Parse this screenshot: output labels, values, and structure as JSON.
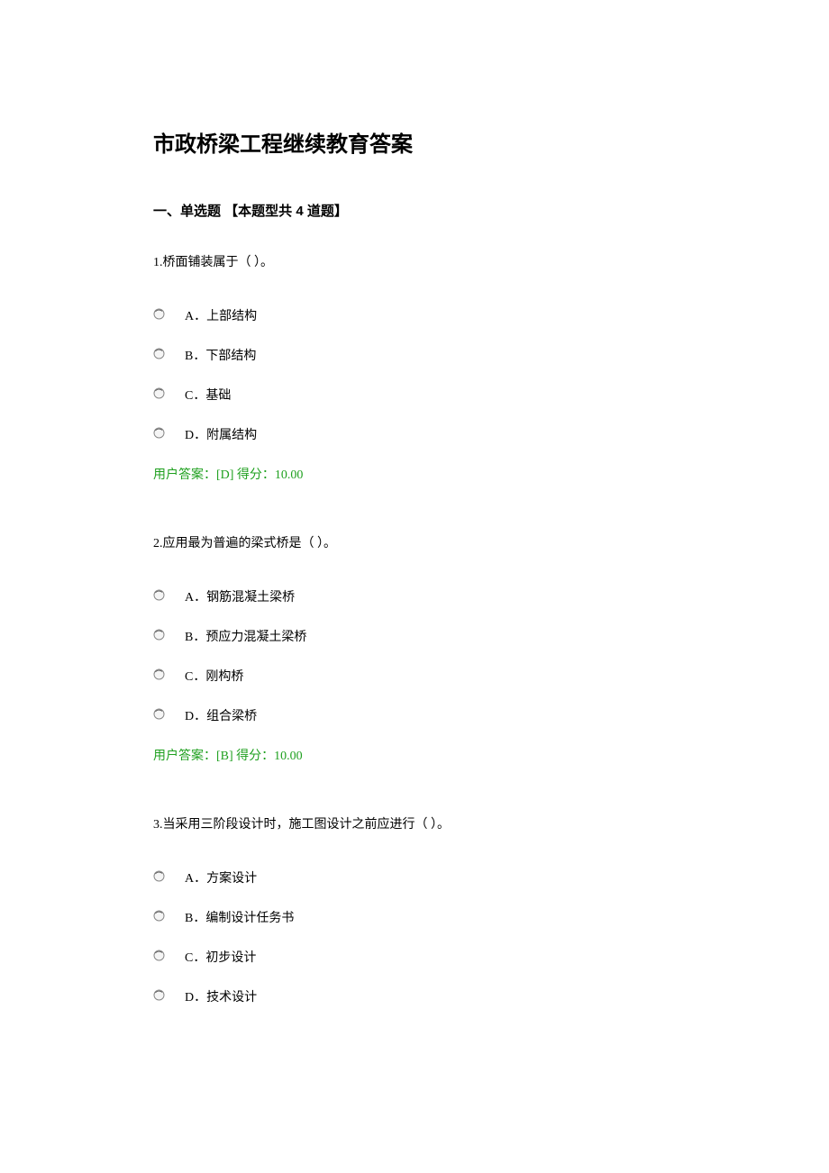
{
  "title": "市政桥梁工程继续教育答案",
  "section_header": "一、单选题 【本题型共 4 道题】",
  "questions": [
    {
      "text": "1.桥面铺装属于（ ）。",
      "options": [
        {
          "label": "A．上部结构"
        },
        {
          "label": "B．下部结构"
        },
        {
          "label": "C．基础"
        },
        {
          "label": "D．附属结构"
        }
      ],
      "answer": "用户答案：[D] 得分：10.00"
    },
    {
      "text": "2.应用最为普遍的梁式桥是（ ）。",
      "options": [
        {
          "label": "A．钢筋混凝土梁桥"
        },
        {
          "label": "B．预应力混凝土梁桥"
        },
        {
          "label": "C．刚构桥"
        },
        {
          "label": "D．组合梁桥"
        }
      ],
      "answer": "用户答案：[B] 得分：10.00"
    },
    {
      "text": "3.当采用三阶段设计时，施工图设计之前应进行（ ）。",
      "options": [
        {
          "label": "A．方案设计"
        },
        {
          "label": "B．编制设计任务书"
        },
        {
          "label": "C．初步设计"
        },
        {
          "label": "D．技术设计"
        }
      ],
      "answer": ""
    }
  ]
}
